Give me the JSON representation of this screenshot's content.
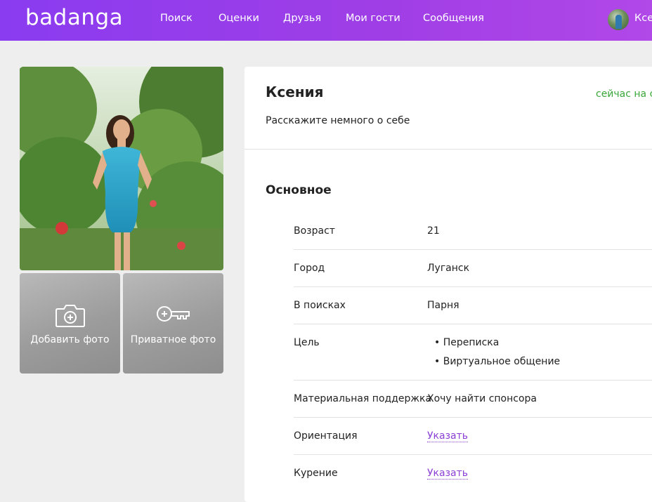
{
  "header": {
    "logo": "badanga",
    "nav": [
      "Поиск",
      "Оценки",
      "Друзья",
      "Мои гости",
      "Сообщения"
    ],
    "user_name": "Ксения"
  },
  "left": {
    "add_photo_label": "Добавить фото",
    "private_photo_label": "Приватное фото"
  },
  "profile": {
    "name": "Ксения",
    "status": "сейчас на сайте",
    "about": "Расскажите немного о себе",
    "section_title": "Основное",
    "fields": {
      "age": {
        "label": "Возраст",
        "value": "21"
      },
      "city": {
        "label": "Город",
        "value": "Луганск"
      },
      "seeking": {
        "label": "В поисках",
        "value": "Парня"
      },
      "goal": {
        "label": "Цель",
        "values": [
          "Переписка",
          "Виртуальное общение"
        ]
      },
      "support": {
        "label": "Материальная поддержка",
        "value": "Хочу найти спонсора"
      },
      "orientation": {
        "label": "Ориентация",
        "link": "Указать"
      },
      "smoking": {
        "label": "Курение",
        "link": "Указать"
      }
    }
  },
  "colors": {
    "header_gradient_start": "#8a3cf0",
    "header_gradient_end": "#b148e8",
    "online": "#3aa63a",
    "link": "#8b3fd6"
  }
}
